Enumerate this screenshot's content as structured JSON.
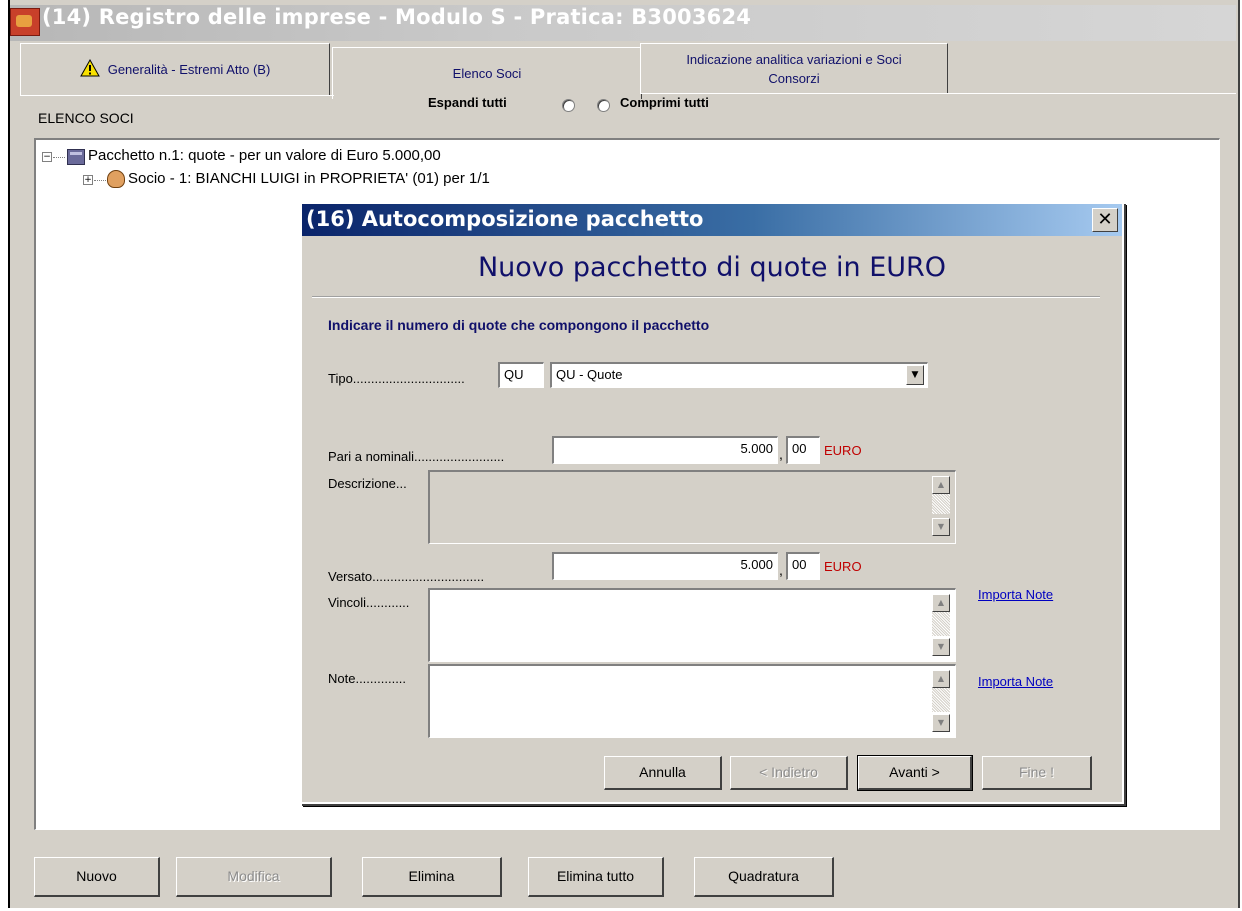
{
  "window": {
    "title": "(14) Registro delle imprese - Modulo S - Pratica: B3003624"
  },
  "tabs": [
    {
      "label": "Generalità - Estremi Atto (B)",
      "icon": "warning-icon",
      "active": false
    },
    {
      "label": "Elenco Soci",
      "active": true
    },
    {
      "label_line1": "Indicazione analitica variazioni e Soci",
      "label_line2": "Consorzi",
      "active": false
    }
  ],
  "header": {
    "section_label": "ELENCO SOCI",
    "expand_label": "Espandi tutti",
    "collapse_label": "Comprimi tutti"
  },
  "tree": {
    "items": [
      {
        "text": "Pacchetto n.1: quote - per un valore di Euro 5.000,00",
        "icon": "package-icon",
        "expander": "−"
      },
      {
        "text": "Socio - 1: BIANCHI LUIGI in PROPRIETA' (01) per 1/1",
        "icon": "person-icon",
        "expander": "+"
      }
    ]
  },
  "dialog": {
    "title": "(16) Autocomposizione pacchetto",
    "close_glyph": "✕",
    "heading": "Nuovo pacchetto di quote in EURO",
    "instruction": "Indicare il numero di quote che compongono il pacchetto",
    "tipo": {
      "label": "Tipo...............................",
      "code": "QU",
      "selected": "QU - Quote"
    },
    "nominali": {
      "label": "Pari a  nominali.........................",
      "integer": "5.000",
      "decimal": "00",
      "currency": "EURO"
    },
    "descrizione": {
      "label": "Descrizione..."
    },
    "versato": {
      "label": "Versato...............................",
      "integer": "5.000",
      "decimal": "00",
      "currency": "EURO"
    },
    "vincoli": {
      "label": "Vincoli............",
      "link": "Importa Note"
    },
    "note": {
      "label": "Note..............",
      "link": "Importa Note"
    },
    "buttons": {
      "annulla": "Annulla",
      "indietro": "< Indietro",
      "avanti": "Avanti >",
      "fine": "Fine !"
    }
  },
  "bottom_buttons": {
    "nuovo": "Nuovo",
    "modifica": "Modifica",
    "elimina": "Elimina",
    "elimina_tutto": "Elimina tutto",
    "quadratura": "Quadratura"
  },
  "colors": {
    "dialog_title_start": "#0a246a",
    "dialog_title_end": "#a6caf0",
    "heading_text": "#10106a",
    "currency_red": "#c00000",
    "link_blue": "#0000c0"
  }
}
